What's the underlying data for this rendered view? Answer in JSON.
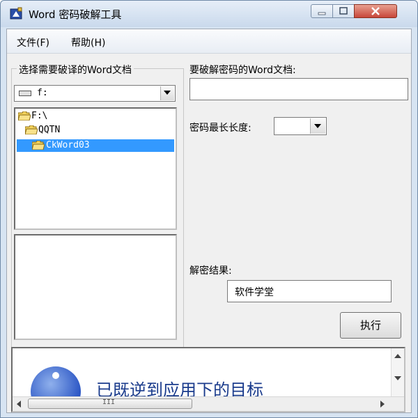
{
  "window": {
    "title": "Word 密码破解工具",
    "buttons": {
      "minimize": "minimize-icon",
      "maximize": "maximize-icon",
      "close": "close-icon"
    }
  },
  "menu": {
    "items": [
      {
        "label": "文件(F)"
      },
      {
        "label": "帮助(H)"
      }
    ]
  },
  "source": {
    "group_label": "选择需要破译的Word文档",
    "drive": {
      "value": "f:"
    },
    "directories": [
      {
        "name": "F:\\",
        "selected": false
      },
      {
        "name": "QQTN",
        "selected": false
      },
      {
        "name": "CkWord03",
        "selected": true
      }
    ],
    "files": []
  },
  "target": {
    "doc_label": "要破解密码的Word文档:",
    "doc_value": "",
    "max_len_label": "密码最长长度:",
    "max_len_value": "",
    "result_label": "解密结果:",
    "result_value": "软件学堂",
    "execute_label": "执行"
  },
  "bottom": {
    "partial_text": "已既逆到应用下的目标"
  },
  "colors": {
    "selection": "#3399ff",
    "client_bg": "#f0f0f0",
    "title_bg": "#c9d9ec"
  }
}
